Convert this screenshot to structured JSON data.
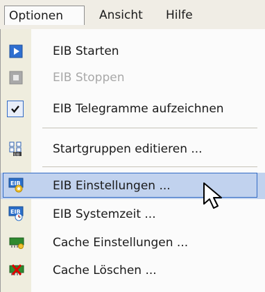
{
  "menubar": {
    "items": [
      {
        "label": "Optionen",
        "active": true
      },
      {
        "label": "Ansicht"
      },
      {
        "label": "Hilfe"
      }
    ]
  },
  "menu": {
    "items": [
      {
        "label": "EIB Starten",
        "icon": "play-icon"
      },
      {
        "label": "EIB Stoppen",
        "icon": "stop-icon",
        "disabled": true
      },
      {
        "label": "EIB Telegramme aufzeichnen",
        "icon": "checkmark-icon",
        "checked": true
      },
      {
        "label": "Startgruppen editieren ...",
        "icon": "groups-icon"
      },
      {
        "label": "EIB Einstellungen ...",
        "icon": "eib-settings-icon",
        "hover": true
      },
      {
        "label": "EIB Systemzeit ...",
        "icon": "eib-systemtime-icon"
      },
      {
        "label": "Cache Einstellungen ...",
        "icon": "cache-settings-icon"
      },
      {
        "label": "Cache Löschen ...",
        "icon": "cache-delete-icon"
      }
    ]
  },
  "colors": {
    "gutter": "#efedde",
    "hover_fill": "#c1d2ee",
    "hover_border": "#316ac5",
    "play_blue": "#2f6fd0",
    "disabled_text": "#a8a8a8"
  }
}
